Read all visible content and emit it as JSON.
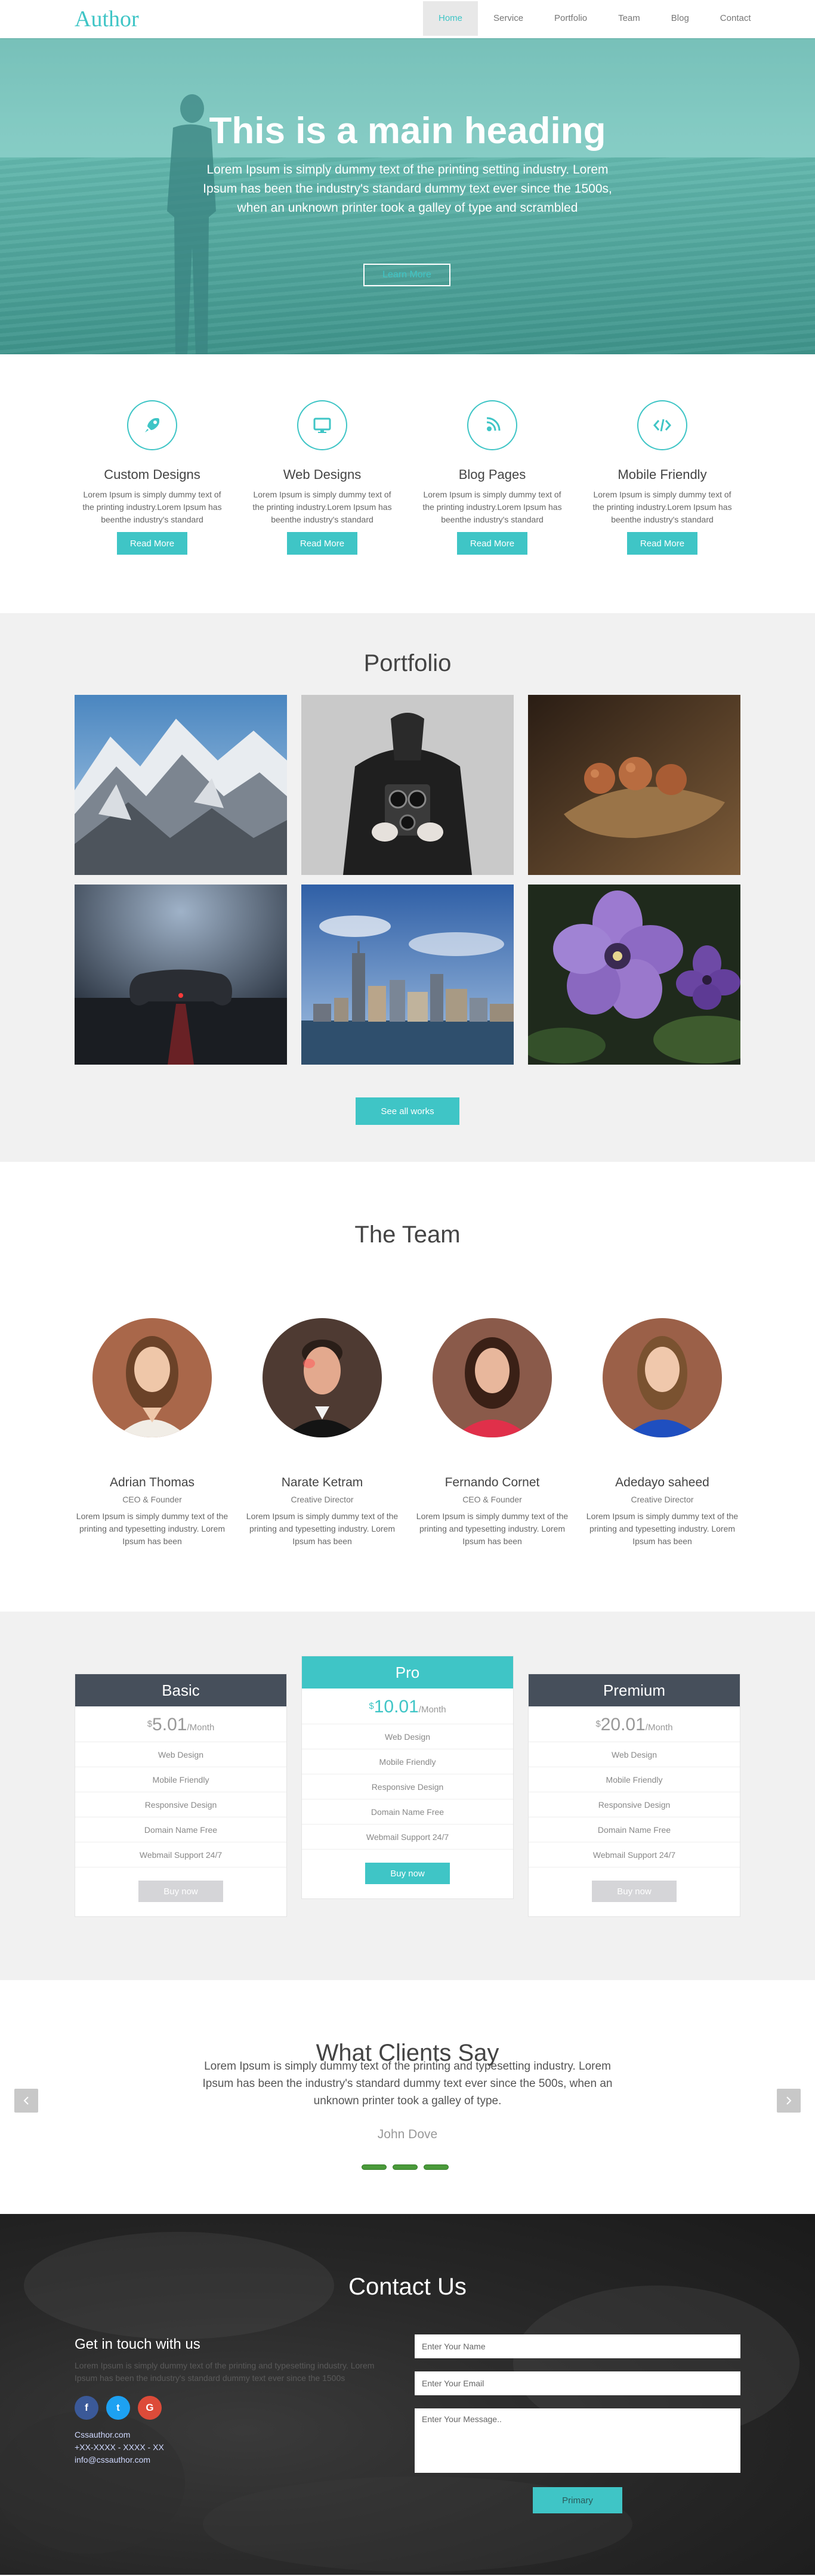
{
  "nav": {
    "logo": "Author",
    "items": [
      {
        "label": "Home",
        "active": true
      },
      {
        "label": "Service"
      },
      {
        "label": "Portfolio"
      },
      {
        "label": "Team"
      },
      {
        "label": "Blog"
      },
      {
        "label": "Contact"
      }
    ]
  },
  "hero": {
    "heading": "This is a main heading",
    "text": "Lorem Ipsum is simply dummy text of the printing setting industry. Lorem Ipsum has been the industry's standard dummy text ever since the 1500s, when an unknown printer took a galley of type and scrambled",
    "button": "Learn More"
  },
  "features": [
    {
      "icon": "rocket-icon",
      "title": "Custom Designs",
      "text": "Lorem Ipsum is simply dummy text of the printing industry.Lorem Ipsum has beenthe industry's standard",
      "button": "Read More"
    },
    {
      "icon": "monitor-icon",
      "title": "Web Designs",
      "text": "Lorem Ipsum is simply dummy text of the printing industry.Lorem Ipsum has beenthe industry's standard",
      "button": "Read More"
    },
    {
      "icon": "blog-icon",
      "title": "Blog Pages",
      "text": "Lorem Ipsum is simply dummy text of the printing industry.Lorem Ipsum has beenthe industry's standard",
      "button": "Read More"
    },
    {
      "icon": "code-icon",
      "title": "Mobile Friendly",
      "text": "Lorem Ipsum is simply dummy text of the printing industry.Lorem Ipsum has beenthe industry's standard",
      "button": "Read More"
    }
  ],
  "portfolio": {
    "title": "Portfolio",
    "button": "See all works"
  },
  "team": {
    "title": "The Team",
    "members": [
      {
        "name": "Adrian Thomas",
        "role": "CEO & Founder",
        "text": "Lorem Ipsum is simply dummy text of the printing and typesetting industry. Lorem Ipsum has been"
      },
      {
        "name": "Narate Ketram",
        "role": "Creative Director",
        "text": "Lorem Ipsum is simply dummy text of the printing and typesetting industry. Lorem Ipsum has been"
      },
      {
        "name": "Fernando Cornet",
        "role": "CEO & Founder",
        "text": "Lorem Ipsum is simply dummy text of the printing and typesetting industry. Lorem Ipsum has been"
      },
      {
        "name": "Adedayo saheed",
        "role": "Creative Director",
        "text": "Lorem Ipsum is simply dummy text of the printing and typesetting industry. Lorem Ipsum has been"
      }
    ]
  },
  "pricing": {
    "plans": [
      {
        "name": "Basic",
        "currency": "$",
        "price": "5.01",
        "period": "/Month",
        "features": [
          "Web Design",
          "Mobile Friendly",
          "Responsive Design",
          "Domain Name Free",
          "Webmail Support 24/7"
        ],
        "button": "Buy now"
      },
      {
        "name": "Pro",
        "currency": "$",
        "price": "10.01",
        "period": "/Month",
        "features": [
          "Web Design",
          "Mobile Friendly",
          "Responsive Design",
          "Domain Name Free",
          "Webmail Support 24/7"
        ],
        "button": "Buy now"
      },
      {
        "name": "Premium",
        "currency": "$",
        "price": "20.01",
        "period": "/Month",
        "features": [
          "Web Design",
          "Mobile Friendly",
          "Responsive Design",
          "Domain Name Free",
          "Webmail Support 24/7"
        ],
        "button": "Buy now"
      }
    ]
  },
  "clients": {
    "title": "What Clients Say",
    "quote": "Lorem Ipsum is simply dummy text of the printing and typesetting industry. Lorem Ipsum has been the industry's standard dummy text ever since the 500s, when an unknown printer took a galley of type.",
    "author": "John Dove"
  },
  "contact": {
    "title": "Contact Us",
    "subtitle": "Get in touch with us",
    "text": "Lorem Ipsum is simply dummy text of the printing and typesetting industry. Lorem Ipsum has been the industry's standard dummy text ever since the 1500s",
    "website": "Cssauthor.com",
    "phone": "+XX-XXXX - XXXX - XX",
    "email": "info@cssauthor.com",
    "name_placeholder": "Enter Your Name",
    "email_placeholder": "Enter Your Email",
    "message_placeholder": "Enter Your Message..",
    "button": "Primary",
    "social": [
      {
        "icon": "facebook-icon",
        "glyph": "f",
        "color": "#3b5998"
      },
      {
        "icon": "twitter-icon",
        "glyph": "t",
        "color": "#1da1f2"
      },
      {
        "icon": "google-plus-icon",
        "glyph": "G",
        "color": "#dd4b39"
      }
    ]
  },
  "colors": {
    "accent": "#3fc5c6",
    "plan_head": "#464f5b",
    "buy_disabled": "#d5d5d8"
  }
}
